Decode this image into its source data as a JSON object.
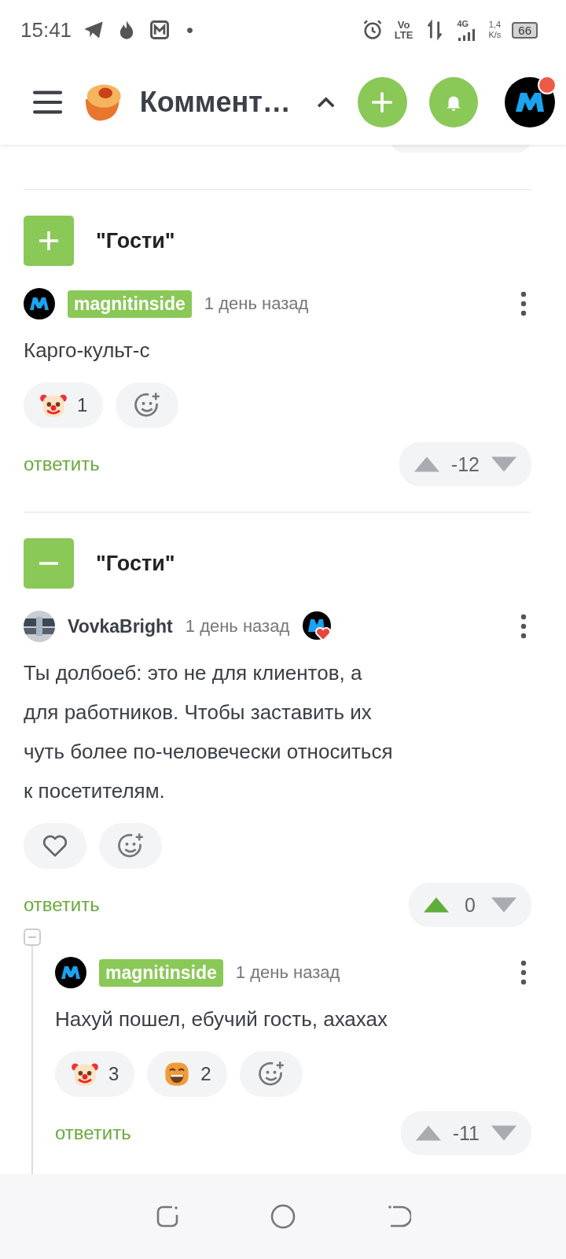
{
  "status_bar": {
    "time": "15:41",
    "volte_top": "Vo",
    "volte_bottom": "LTE",
    "network": "4G",
    "speed_value": "1,4",
    "speed_unit": "K/s",
    "battery": "66"
  },
  "header": {
    "title": "Коммент…",
    "notification_dot": true
  },
  "threads": [
    {
      "title": "\"Гости\"",
      "expanded": false,
      "comment": {
        "author": "magnitinside",
        "highlighted": true,
        "avatar": {
          "kind": "brand"
        },
        "award": false,
        "time": "1 день назад",
        "text": "Карго-культ-с",
        "reactions": [
          {
            "kind": "clown",
            "count": "1"
          },
          {
            "kind": "add"
          }
        ],
        "score": "-12",
        "upvoted": false,
        "reply": "ответить"
      }
    },
    {
      "title": "\"Гости\"",
      "expanded": true,
      "comment": {
        "author": "VovkaBright",
        "highlighted": false,
        "award": true,
        "time": "1 день назад",
        "text": "Ты долбоеб: это не для клиентов, а\nдля работников. Чтобы заставить их\nчуть более по-человечески относиться\nк посетителям.",
        "reactions": [
          {
            "kind": "heart"
          },
          {
            "kind": "add"
          }
        ],
        "score": "0",
        "upvoted": true,
        "reply": "ответить",
        "replies": [
          {
            "author": "magnitinside",
            "highlighted": true,
            "avatar": {
              "kind": "brand"
            },
            "award": false,
            "time": "1 день назад",
            "text": "Нахуй пошел, ебучий гость, ахахах",
            "reactions": [
              {
                "kind": "clown",
                "count": "3"
              },
              {
                "kind": "grin",
                "count": "2"
              },
              {
                "kind": "add"
              }
            ],
            "score": "-11",
            "upvoted": false,
            "reply": "ответить"
          }
        ]
      }
    }
  ]
}
